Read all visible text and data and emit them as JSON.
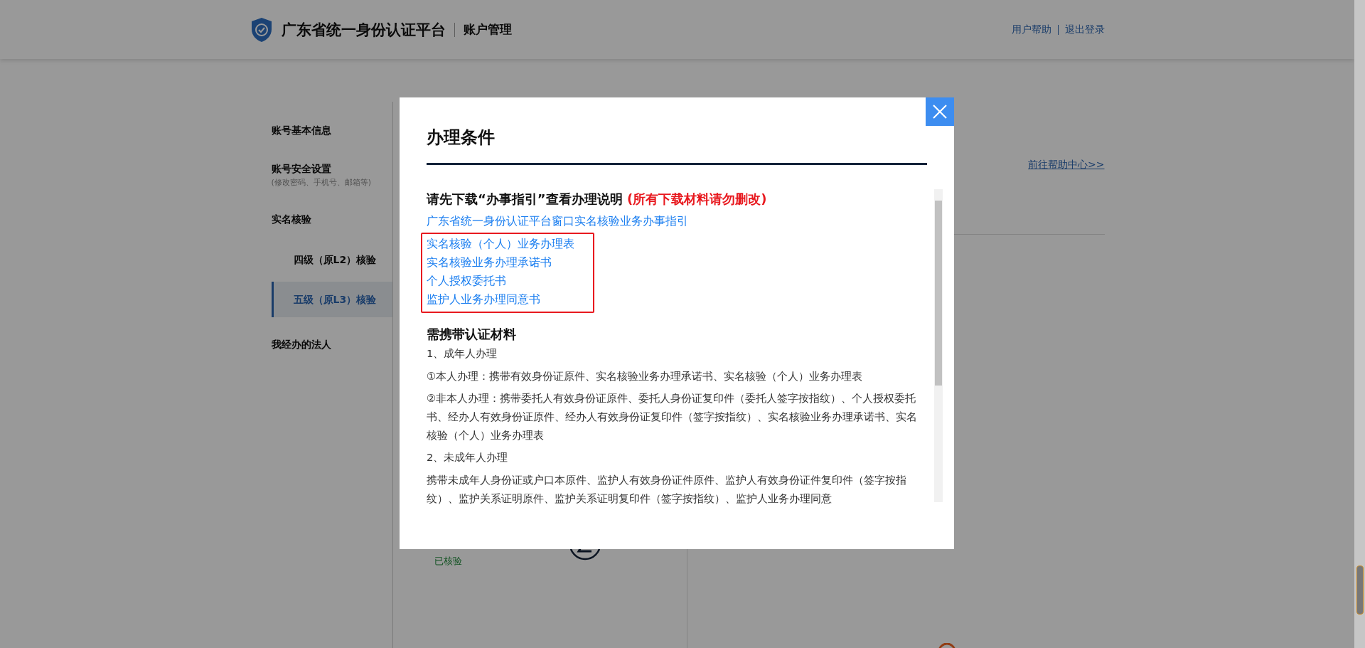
{
  "header": {
    "title": "广东省统一身份认证平台",
    "section": "账户管理",
    "links": [
      {
        "label": "用户帮助"
      },
      {
        "label": "退出登录"
      }
    ]
  },
  "sidebar": {
    "items": [
      {
        "label": "账号基本信息",
        "selected": false
      },
      {
        "label": "账号安全设置",
        "note": "(修改密码、手机号、邮箱等)",
        "selected": false
      },
      {
        "label": "实名核验",
        "selected": false,
        "children": [
          {
            "label": "四级（原L2）核验",
            "selected": false
          },
          {
            "label": "五级（原L3）核验",
            "selected": true
          }
        ]
      },
      {
        "label": "我经办的法人",
        "selected": false
      }
    ]
  },
  "main": {
    "help_link": "前往帮助中心>>",
    "card": {
      "status": "已核验"
    }
  },
  "modal": {
    "title": "办理条件",
    "download_heading": "请先下载“办事指引”查看办理说明 ",
    "download_warning": "(所有下载材料请勿删改)",
    "guide_link": "广东省统一身份认证平台窗口实名核验业务办事指引",
    "highlighted_links": [
      {
        "label": "实名核验（个人）业务办理表"
      },
      {
        "label": "实名核验业务办理承诺书"
      },
      {
        "label": "个人授权委托书"
      },
      {
        "label": "监护人业务办理同意书"
      }
    ],
    "materials_heading": "需携带认证材料",
    "paragraphs": [
      {
        "kind": "section",
        "text": "1、成年人办理"
      },
      {
        "kind": "item",
        "text": "①本人办理：携带有效身份证原件、实名核验业务办理承诺书、实名核验（个人）业务办理表"
      },
      {
        "kind": "item",
        "text": "②非本人办理：携带委托人有效身份证原件、委托人身份证复印件（委托人签字按指纹）、个人授权委托书、经办人有效身份证原件、经办人有效身份证复印件（签字按指纹）、实名核验业务办理承诺书、实名核验（个人）业务办理表"
      },
      {
        "kind": "section",
        "text": "2、未成年人办理"
      },
      {
        "kind": "item",
        "text": "携带未成年人身份证或户口本原件、监护人有效身份证件原件、监护人有效身份证件复印件（签字按指纹）、监护关系证明原件、监护关系证明复印件（签字按指纹）、监护人业务办理同意"
      }
    ]
  }
}
